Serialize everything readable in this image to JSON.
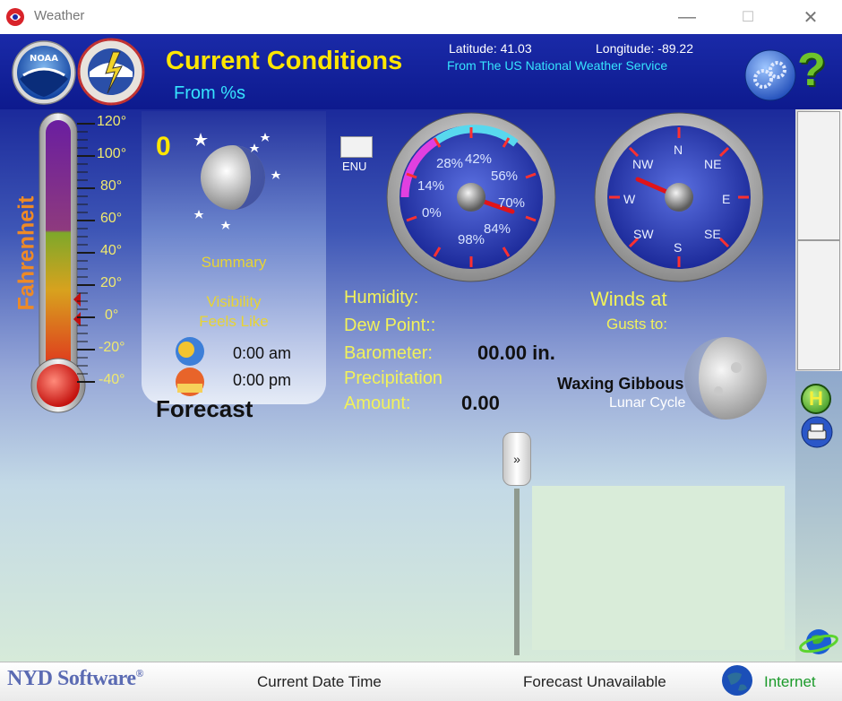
{
  "window": {
    "title": "Weather",
    "minimize": "—",
    "maximize": "☐",
    "close": "✕"
  },
  "header": {
    "title": "Current Conditions",
    "subtitle": "From %s",
    "latitude": "Latitude: 41.03",
    "longitude": "Longitude: -89.22",
    "source": "From The US National Weather Service",
    "noaa_logo_text": "NOAA"
  },
  "thermometer": {
    "unit_label": "Fahrenheit",
    "ticks": [
      "120°",
      "100°",
      "80°",
      "60°",
      "40°",
      "20°",
      "0°",
      "-20°",
      "-40°"
    ]
  },
  "moon_card": {
    "temperature": "0",
    "summary": "Summary",
    "visibility": "Visibility",
    "feels_like": "Feels Like",
    "sunrise": "0:00 am",
    "sunset": "0:00 pm",
    "forecast_heading": "Forecast"
  },
  "humidity_gauge": {
    "labels": [
      "0%",
      "14%",
      "28%",
      "42%",
      "56%",
      "70%",
      "84%",
      "98%"
    ],
    "enu_label": "ENU"
  },
  "compass": {
    "labels": [
      "N",
      "NE",
      "E",
      "SE",
      "S",
      "SW",
      "W",
      "NW"
    ]
  },
  "conditions": {
    "humidity": "Humidity:",
    "dew_point": "Dew Point::",
    "barometer": "Barometer:",
    "barometer_value": "00.00 in.",
    "precipitation": "Precipitation",
    "amount": "Amount:",
    "amount_value": "0.00",
    "winds": "Winds at",
    "gusts": "Gusts to:",
    "moon_phase": "Waxing Gibbous",
    "lunar_cycle": "Lunar Cycle"
  },
  "status_bar": {
    "brand": "NYD Software",
    "brand_mark": "®",
    "current_date_time": "Current Date Time",
    "forecast_status": "Forecast Unavailable",
    "connection": "Internet"
  },
  "sidebar": {
    "help_badge": "H",
    "question": "?"
  }
}
